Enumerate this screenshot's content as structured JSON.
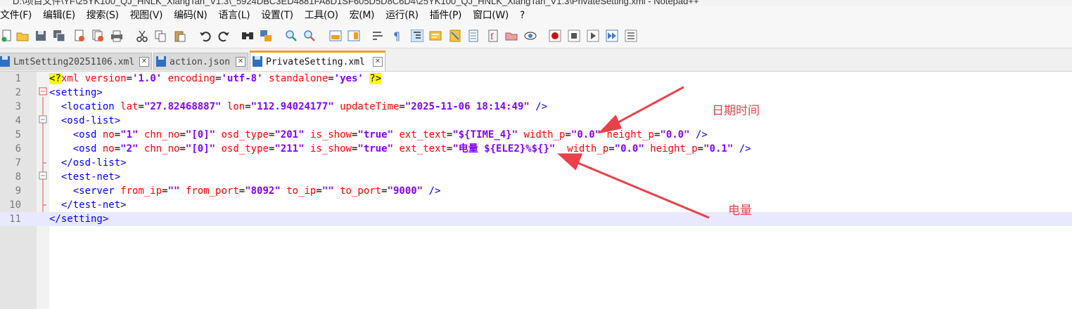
{
  "window": {
    "title": "D:\\项目文件\\YF\\25YK100_QJ_HNLK_XiangTan_V1.3\\_5924DBC3ED4881FA8D1SF605D5D8C6D4\\25YK100_QJ_HNLK_XiangTan_V1.3\\PrivateSetting.xml - Notepad++"
  },
  "menu": [
    "文件(F)",
    "编辑(E)",
    "搜索(S)",
    "视图(V)",
    "编码(N)",
    "语言(L)",
    "设置(T)",
    "工具(O)",
    "宏(M)",
    "运行(R)",
    "插件(P)",
    "窗口(W)",
    "?"
  ],
  "toolbar": {
    "icons": [
      "new-file-icon",
      "open-file-icon",
      "save-icon",
      "save-all-icon",
      "close-icon",
      "close-all-icon",
      "print-icon",
      "cut-icon",
      "copy-icon",
      "paste-icon",
      "undo-icon",
      "redo-icon",
      "find-icon",
      "replace-icon",
      "zoom-in-icon",
      "zoom-out-icon",
      "sync-vertical-icon",
      "sync-horizontal-icon",
      "word-wrap-icon",
      "show-all-chars-icon",
      "indent-guide-icon",
      "user-lang-icon",
      "doc-map-icon",
      "doc-list-icon",
      "function-list-icon",
      "folder-workspace-icon",
      "monitor-icon",
      "record-macro-icon",
      "stop-record-icon",
      "play-macro-icon",
      "run-macro-multiple-icon",
      "save-macro-icon"
    ]
  },
  "tabs": [
    {
      "label": "LmtSetting20251106.xml",
      "active": false
    },
    {
      "label": "action.json",
      "active": false
    },
    {
      "label": "PrivateSetting.xml",
      "active": true
    }
  ],
  "editor": {
    "line_numbers": [
      "1",
      "2",
      "3",
      "4",
      "5",
      "6",
      "7",
      "8",
      "9",
      "10",
      "11"
    ],
    "current_line": 11
  },
  "code": {
    "l1_pi_open": "<?",
    "l1_xml": "xml",
    "l1_sp1": " ",
    "l1_a1": "version",
    "l1_eq1": "=",
    "l1_v1": "'1.0'",
    "l1_sp2": " ",
    "l1_a2": "encoding",
    "l1_eq2": "=",
    "l1_v2": "'utf-8'",
    "l1_sp3": " ",
    "l1_a3": "standalone",
    "l1_eq3": "=",
    "l1_v3": "'yes'",
    "l1_sp4": " ",
    "l1_pi_close": "?>",
    "l2": "<setting>",
    "l3_open": "  <location ",
    "l3_a1": "lat",
    "l3_e1": "=",
    "l3_v1": "\"27.82468887\"",
    "l3_s1": " ",
    "l3_a2": "lon",
    "l3_e2": "=",
    "l3_v2": "\"112.94024177\"",
    "l3_s2": " ",
    "l3_a3": "updateTime",
    "l3_e3": "=",
    "l3_v3": "\"2025-11-06 18:14:49\"",
    "l3_close": " />",
    "l4": "  <osd-list>",
    "l5_open": "    <osd ",
    "l5_a1": "no",
    "l5_e1": "=",
    "l5_v1": "\"1\"",
    "l5_s1": " ",
    "l5_a2": "chn_no",
    "l5_e2": "=",
    "l5_v2": "\"[0]\"",
    "l5_s2": " ",
    "l5_a3": "osd_type",
    "l5_e3": "=",
    "l5_v3": "\"201\"",
    "l5_s3": " ",
    "l5_a4": "is_show",
    "l5_e4": "=",
    "l5_v4": "\"true\"",
    "l5_s4": " ",
    "l5_a5": "ext_text",
    "l5_e5": "=",
    "l5_v5": "\"${TIME_4}\"",
    "l5_s5": " ",
    "l5_a6": "width_p",
    "l5_e6": "=",
    "l5_v6": "\"0.0\"",
    "l5_s6": " ",
    "l5_a7": "height_p",
    "l5_e7": "=",
    "l5_v7": "\"0.0\"",
    "l5_close": " />",
    "l6_open": "    <osd ",
    "l6_a1": "no",
    "l6_e1": "=",
    "l6_v1": "\"2\"",
    "l6_s1": " ",
    "l6_a2": "chn_no",
    "l6_e2": "=",
    "l6_v2": "\"[0]\"",
    "l6_s2": " ",
    "l6_a3": "osd_type",
    "l6_e3": "=",
    "l6_v3": "\"211\"",
    "l6_s3": " ",
    "l6_a4": "is_show",
    "l6_e4": "=",
    "l6_v4": "\"true\"",
    "l6_s4": " ",
    "l6_a5": "ext_text",
    "l6_e5": "=",
    "l6_v5": "\"电量 ${ELE2}%${}\"",
    "l6_s5": "  ",
    "l6_a6": "width_p",
    "l6_e6": "=",
    "l6_v6": "\"0.0\"",
    "l6_s6": " ",
    "l6_a7": "height_p",
    "l6_e7": "=",
    "l6_v7": "\"0.1\"",
    "l6_close": " />",
    "l7": "  </osd-list>",
    "l8": "  <test-net>",
    "l9_open": "    <server ",
    "l9_a1": "from_ip",
    "l9_e1": "=",
    "l9_v1": "\"\"",
    "l9_s1": " ",
    "l9_a2": "from_port",
    "l9_e2": "=",
    "l9_v2": "\"8092\"",
    "l9_s2": " ",
    "l9_a3": "to_ip",
    "l9_e3": "=",
    "l9_v3": "\"\"",
    "l9_s3": " ",
    "l9_a4": "to_port",
    "l9_e4": "=",
    "l9_v4": "\"9000\"",
    "l9_close": " />",
    "l10": "  </test-net>",
    "l11": "</setting>"
  },
  "annotations": {
    "datetime_label": "日期时间",
    "battery_label": "电量",
    "color": "#e8414b"
  }
}
